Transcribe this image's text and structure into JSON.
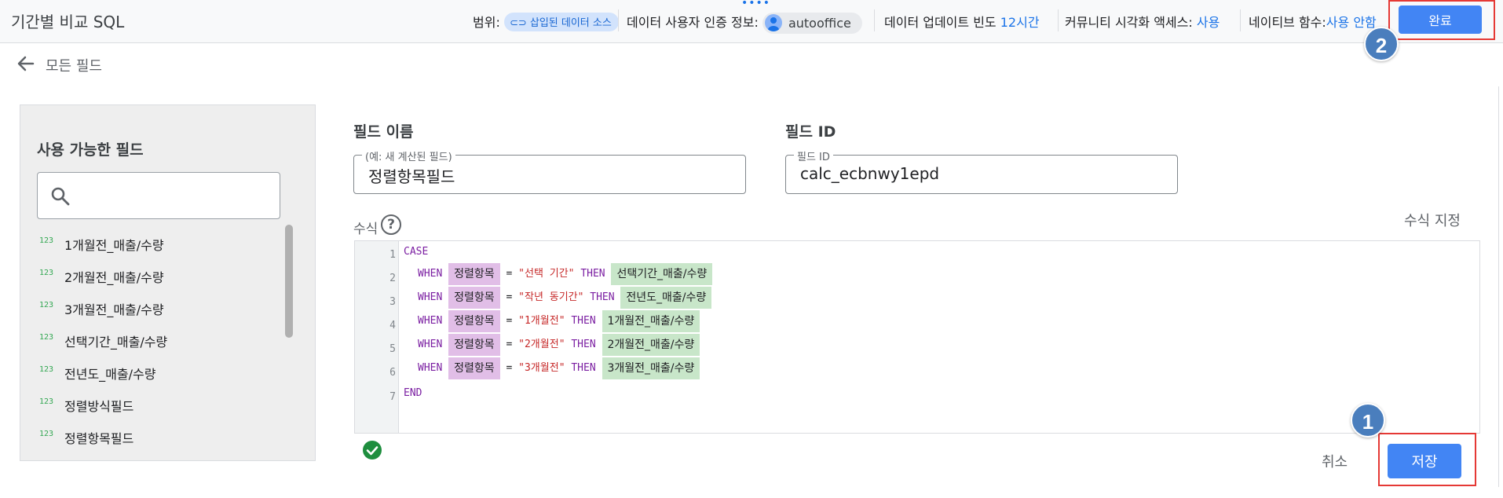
{
  "header": {
    "title": "기간별 비교 SQL",
    "scope_label": "범위:",
    "scope_chip": "삽입된 데이터 소스",
    "credentials_label": "데이터 사용자 인증 정보:",
    "credentials_user": "autooffice",
    "freshness_label": "데이터 업데이트 빈도",
    "freshness_value": "12시간",
    "community_label": "커뮤니티 시각화 액세스:",
    "community_value": "사용",
    "native_label": "네이티브 함수:",
    "native_value": "사용 안함",
    "done_label": "완료"
  },
  "annotations": {
    "badge_1": "1",
    "badge_2": "2",
    "accent": "#e53935",
    "badge_color": "#4a7ebd"
  },
  "nav": {
    "back_label": "모든 필드"
  },
  "available_fields": {
    "title": "사용 가능한 필드",
    "search_placeholder": "",
    "items": [
      {
        "type": "123",
        "label": "1개월전_매출/수량"
      },
      {
        "type": "123",
        "label": "2개월전_매출/수량"
      },
      {
        "type": "123",
        "label": "3개월전_매출/수량"
      },
      {
        "type": "123",
        "label": "선택기간_매출/수량"
      },
      {
        "type": "123",
        "label": "전년도_매출/수량"
      },
      {
        "type": "123",
        "label": "정렬방식필드"
      },
      {
        "type": "123",
        "label": "정렬항목필드"
      }
    ]
  },
  "field_name": {
    "label": "필드 이름",
    "legend": "(예: 새 계산된 필드)",
    "value": "정렬항목필드"
  },
  "field_id": {
    "label": "필드 ID",
    "legend": "필드 ID",
    "value": "calc_ecbnwy1epd"
  },
  "formula": {
    "label": "수식",
    "help": "?",
    "format_label": "수식 지정",
    "kw_case": "CASE",
    "kw_when": "WHEN",
    "kw_then": "THEN",
    "kw_end": "END",
    "eq": "=",
    "lines": [
      "1",
      "2",
      "3",
      "4",
      "5",
      "6",
      "7"
    ],
    "rows": [
      {
        "dim": "정렬항목",
        "str": "\"선택 기간\"",
        "met": "선택기간_매출/수량"
      },
      {
        "dim": "정렬항목",
        "str": "\"작년 동기간\"",
        "met": "전년도_매출/수량"
      },
      {
        "dim": "정렬항목",
        "str": "\"1개월전\"",
        "met": "1개월전_매출/수량"
      },
      {
        "dim": "정렬항목",
        "str": "\"2개월전\"",
        "met": "2개월전_매출/수량"
      },
      {
        "dim": "정렬항목",
        "str": "\"3개월전\"",
        "met": "3개월전_매출/수량"
      }
    ]
  },
  "footer": {
    "cancel_label": "취소",
    "save_label": "저장"
  },
  "colors": {
    "primary": "#4285f4",
    "link": "#1a73e8",
    "dimension_pill": "#e1bee7",
    "metric_pill": "#c8e6c9",
    "valid": "#1e8e3e"
  }
}
